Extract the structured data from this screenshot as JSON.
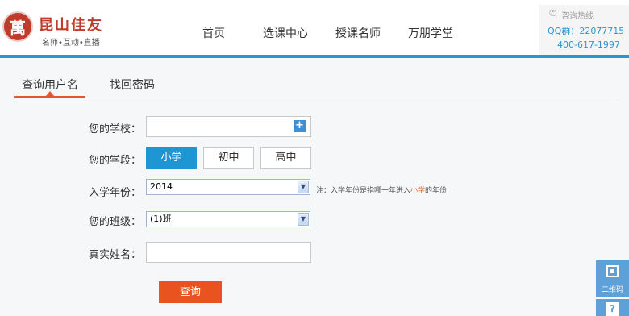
{
  "header": {
    "logo_char": "萬",
    "brand_name": "昆山佳友",
    "brand_sub": "名师•互动•直播",
    "nav": [
      {
        "label": "首页"
      },
      {
        "label": "选课中心"
      },
      {
        "label": "授课名师"
      },
      {
        "label": "万朋学堂"
      }
    ],
    "hotline": {
      "label": "咨询热线",
      "qq": "QQ群：22077715",
      "phone": "400-617-1997"
    }
  },
  "tabs": [
    {
      "label": "查询用户名",
      "active": true
    },
    {
      "label": "找回密码",
      "active": false
    }
  ],
  "form": {
    "school_label": "您的学校：",
    "school_value": "",
    "stage_label": "您的学段：",
    "stages": [
      "小学",
      "初中",
      "高中"
    ],
    "selected_stage": "小学",
    "year_label": "入学年份：",
    "year_value": "2014",
    "year_note_prefix": "注：入学年份是指哪一年进入",
    "year_note_highlight": "小学",
    "year_note_suffix": "的年份",
    "class_label": "您的班级：",
    "class_value": "(1)班",
    "name_label": "真实姓名：",
    "name_value": "",
    "submit_label": "查询"
  },
  "side": {
    "qr_label": "二维码",
    "help_label": "?"
  },
  "colors": {
    "accent_blue": "#2c95d0",
    "accent_orange": "#e8531f",
    "brand_red": "#c23a2a"
  }
}
